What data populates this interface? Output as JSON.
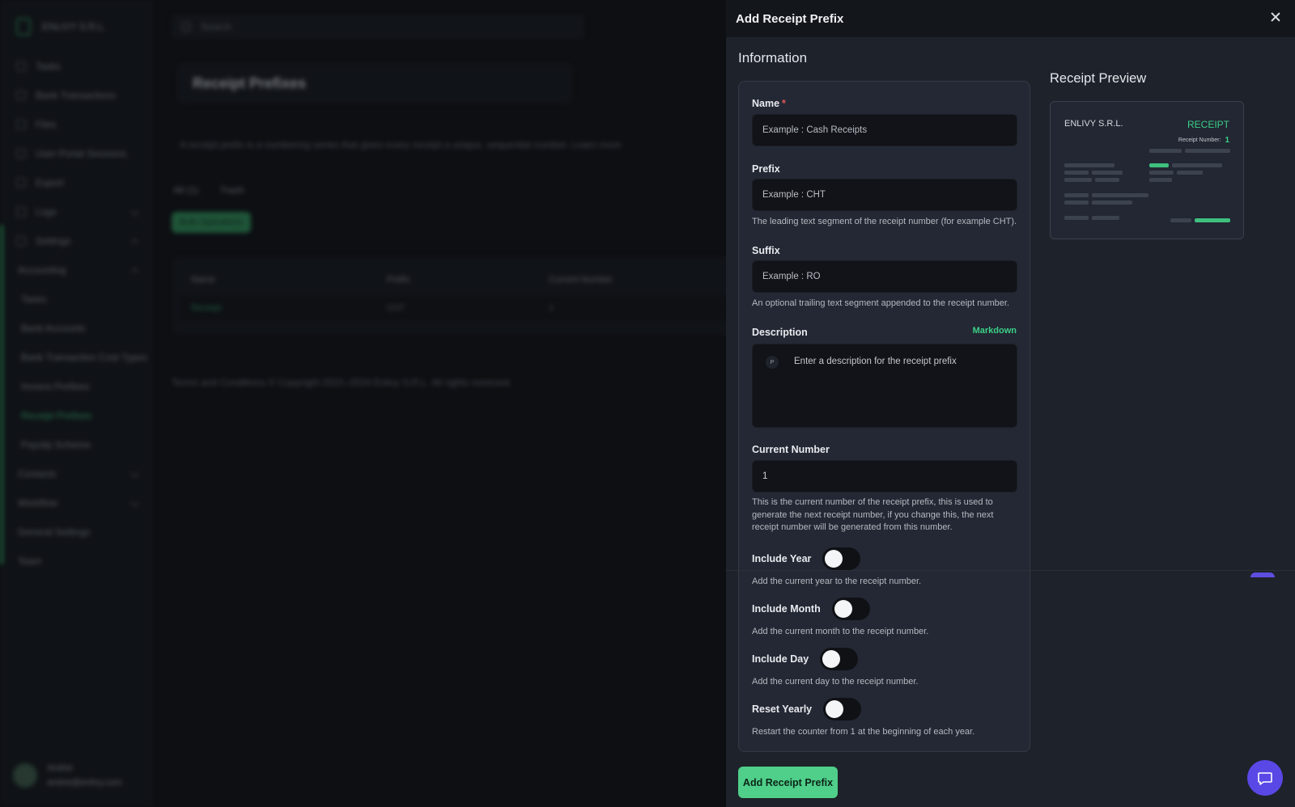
{
  "background": {
    "company": "ENLIVY S.R.L.",
    "search_placeholder": "Search",
    "nav": [
      {
        "label": "Tasks"
      },
      {
        "label": "Bank Transactions"
      },
      {
        "label": "Files"
      },
      {
        "label": "User Portal Sessions"
      },
      {
        "label": "Export"
      },
      {
        "label": "Logs"
      },
      {
        "label": "Settings"
      },
      {
        "label": "Accounting"
      },
      {
        "label": "Taxes"
      },
      {
        "label": "Bank Accounts"
      },
      {
        "label": "Bank Transaction Cost Types"
      },
      {
        "label": "Invoice Prefixes"
      },
      {
        "label": "Receipt Prefixes"
      },
      {
        "label": "Payslip Scheme"
      },
      {
        "label": "Contacts"
      },
      {
        "label": "Workflow"
      },
      {
        "label": "General Settings"
      },
      {
        "label": "Team"
      }
    ],
    "user_name": "Andrei",
    "user_email": "andrei@enlivy.com",
    "page_title": "Receipt Prefixes",
    "info_text": "A receipt prefix is a numbering series that gives every receipt a unique, sequential number.",
    "info_link": "Learn more",
    "action_all": "All (1)",
    "action_trash": "Trash",
    "bulk_label": "Bulk Operations",
    "table_headers": [
      "Name",
      "Prefix",
      "Current Number"
    ],
    "table_row": [
      "Receipt",
      "CHT",
      "1"
    ],
    "footer": "Terms and Conditions   © Copyright 2021–2024 Enlivy S.R.L. All rights reserved."
  },
  "drawer": {
    "title": "Add Receipt Prefix",
    "section_title": "Information",
    "name": {
      "label": "Name",
      "required_mark": "*",
      "placeholder": "Example : Cash Receipts"
    },
    "prefix": {
      "label": "Prefix",
      "placeholder": "Example : CHT",
      "help": "The leading text segment of the receipt number (for example CHT)."
    },
    "suffix": {
      "label": "Suffix",
      "placeholder": "Example : RO",
      "help": "An optional trailing text segment appended to the receipt number."
    },
    "description": {
      "label": "Description",
      "markdown_label": "Markdown",
      "block_type": "P",
      "placeholder": "Enter a description for the receipt prefix"
    },
    "current_number": {
      "label": "Current Number",
      "value": "1",
      "help": "This is the current number of the receipt prefix, this is used to generate the next receipt number, if you change this, the next receipt number will be generated from this number."
    },
    "toggles": {
      "include_year": {
        "label": "Include Year",
        "help": "Add the current year to the receipt number."
      },
      "include_month": {
        "label": "Include Month",
        "help": "Add the current month to the receipt number."
      },
      "include_day": {
        "label": "Include Day",
        "help": "Add the current day to the receipt number."
      },
      "reset_yearly": {
        "label": "Reset Yearly",
        "help": "Restart the counter from 1 at the beginning of each year."
      }
    },
    "submit_label": "Add Receipt Prefix",
    "preview": {
      "title": "Receipt Preview",
      "company": "ENLIVY S.R.L.",
      "doc_type": "RECEIPT",
      "number_label": "Receipt Number:",
      "number_value": "1"
    }
  },
  "colors": {
    "accent": "#3ccf86",
    "button": "#4fcf89",
    "chat": "#5a48e6"
  }
}
